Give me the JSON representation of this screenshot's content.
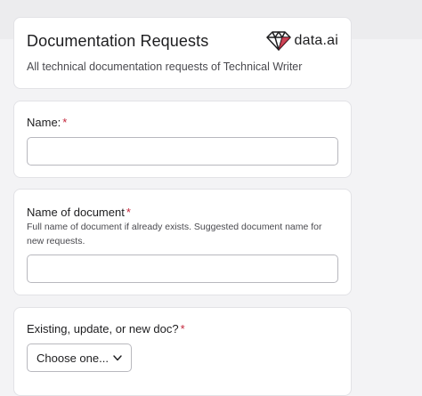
{
  "form": {
    "title": "Documentation Requests",
    "description": "All technical documentation requests of Technical Writer",
    "logo_text": "data.ai"
  },
  "fields": [
    {
      "label": "Name:",
      "required_mark": "*",
      "value": "",
      "placeholder": ""
    },
    {
      "label": "Name of document",
      "required_mark": "*",
      "help": "Full name of document if already exists. Suggested document name for new requests.",
      "value": "",
      "placeholder": ""
    },
    {
      "label": "Existing, update, or new doc?",
      "required_mark": "*",
      "selected": "Choose one..."
    }
  ],
  "colors": {
    "accent_required": "#c4263b",
    "border": "#b8b8be",
    "background": "#f3f3f5"
  },
  "icons": {
    "logo": "diamond-logo-icon",
    "select": "chevron-down-icon"
  }
}
